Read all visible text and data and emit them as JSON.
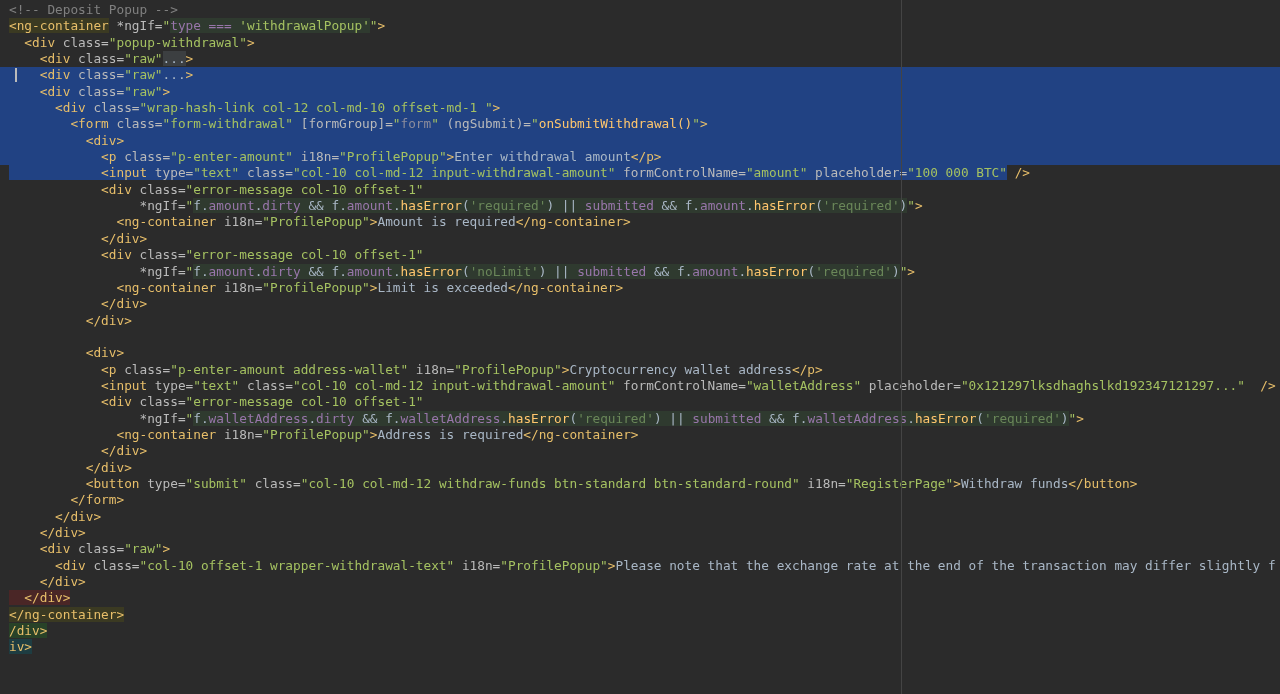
{
  "editor": {
    "lines": [
      {
        "selected": false,
        "cursor": false,
        "tokens": [
          {
            "kind": "comment",
            "text": "<!-- Deposit Popup -->"
          }
        ]
      },
      {
        "selected": false,
        "cursor": false,
        "tokens": [
          {
            "kind": "tag",
            "text": "<ng-container",
            "color": "#3b3a22"
          },
          {
            "kind": "attr",
            "text": " *ngIf="
          },
          {
            "kind": "value",
            "text": "\""
          },
          {
            "kind": "field",
            "text": "type === ",
            "color": "#2f3a2f"
          },
          {
            "kind": "value",
            "text": "'withdrawalPopup'",
            "color": "#2f3a2f"
          },
          {
            "kind": "value",
            "text": "\""
          },
          {
            "kind": "tag",
            "text": ">"
          }
        ]
      },
      {
        "selected": false,
        "cursor": false,
        "tokens": [
          {
            "kind": "tag",
            "text": "  <div"
          },
          {
            "kind": "attr",
            "text": " class="
          },
          {
            "kind": "value",
            "text": "\"popup-withdrawal\""
          },
          {
            "kind": "tag",
            "text": ">"
          }
        ]
      },
      {
        "selected": false,
        "cursor": false,
        "tokens": [
          {
            "kind": "tag",
            "text": "    <div"
          },
          {
            "kind": "attr",
            "text": " class="
          },
          {
            "kind": "value",
            "text": "\"raw\""
          },
          {
            "kind": "plain",
            "text": "...",
            "color": "#3c3f41"
          },
          {
            "kind": "tag",
            "text": ">"
          }
        ]
      },
      {
        "selected": true,
        "cursor": true,
        "tokens": [
          {
            "kind": "tag",
            "text": "    <div"
          },
          {
            "kind": "attr",
            "text": " class="
          },
          {
            "kind": "value",
            "text": "\"raw\""
          },
          {
            "kind": "plain",
            "text": "..."
          },
          {
            "kind": "tag",
            "text": ">"
          }
        ]
      },
      {
        "selected": true,
        "cursor": false,
        "tokens": [
          {
            "kind": "tag",
            "text": "    <div"
          },
          {
            "kind": "attr",
            "text": " class="
          },
          {
            "kind": "value",
            "text": "\"raw\""
          },
          {
            "kind": "tag",
            "text": ">"
          }
        ]
      },
      {
        "selected": true,
        "cursor": false,
        "tokens": [
          {
            "kind": "tag",
            "text": "      <div"
          },
          {
            "kind": "attr",
            "text": " class="
          },
          {
            "kind": "value",
            "text": "\"wrap-hash-link col-12 col-md-10 offset-md-1 \""
          },
          {
            "kind": "tag",
            "text": ">"
          }
        ]
      },
      {
        "selected": true,
        "cursor": false,
        "tokens": [
          {
            "kind": "tag",
            "text": "        <form"
          },
          {
            "kind": "attr",
            "text": " class="
          },
          {
            "kind": "value",
            "text": "\"form-withdrawal\""
          },
          {
            "kind": "attr",
            "text": " [formGroup]="
          },
          {
            "kind": "value",
            "text": "\""
          },
          {
            "kind": "dim",
            "text": "form"
          },
          {
            "kind": "value",
            "text": "\""
          },
          {
            "kind": "attr",
            "text": " (ngSubmit)="
          },
          {
            "kind": "value",
            "text": "\""
          },
          {
            "kind": "call",
            "text": "onSubmitWithdrawal()"
          },
          {
            "kind": "value",
            "text": "\""
          },
          {
            "kind": "tag",
            "text": ">"
          }
        ]
      },
      {
        "selected": true,
        "cursor": false,
        "tokens": [
          {
            "kind": "tag",
            "text": "          <div>"
          }
        ]
      },
      {
        "selected": true,
        "cursor": false,
        "tokens": [
          {
            "kind": "tag",
            "text": "            <p"
          },
          {
            "kind": "attr",
            "text": " class="
          },
          {
            "kind": "value",
            "text": "\"p-enter-amount\""
          },
          {
            "kind": "attr",
            "text": " i18n="
          },
          {
            "kind": "value",
            "text": "\"ProfilePopup\""
          },
          {
            "kind": "tag",
            "text": ">"
          },
          {
            "kind": "plain",
            "text": "Enter withdrawal amount"
          },
          {
            "kind": "tag",
            "text": "</p>"
          }
        ]
      },
      {
        "selected": false,
        "cursor": false,
        "tokens": [
          {
            "kind": "tag",
            "text": "            <input",
            "selected": true
          },
          {
            "kind": "attr",
            "text": " type=",
            "selected": true
          },
          {
            "kind": "value",
            "text": "\"text\"",
            "selected": true
          },
          {
            "kind": "attr",
            "text": " class=",
            "selected": true
          },
          {
            "kind": "value",
            "text": "\"col-10 col-md-12 input-withdrawal-amount\"",
            "selected": true
          },
          {
            "kind": "attr",
            "text": " formControlName=",
            "selected": true
          },
          {
            "kind": "value",
            "text": "\"amount\"",
            "selected": true
          },
          {
            "kind": "attr",
            "text": " placeholder=",
            "selected": true
          },
          {
            "kind": "value",
            "text": "\"100 000 BTC\"",
            "selected": true
          },
          {
            "kind": "tag",
            "text": " />",
            "selected": false
          }
        ]
      },
      {
        "selected": false,
        "cursor": false,
        "tokens": [
          {
            "kind": "tag",
            "text": "            <div"
          },
          {
            "kind": "attr",
            "text": " class="
          },
          {
            "kind": "value",
            "text": "\"error-message col-10 offset-1\""
          }
        ]
      },
      {
        "selected": false,
        "cursor": false,
        "tokens": [
          {
            "kind": "attr",
            "text": "                 *ngIf="
          },
          {
            "kind": "value",
            "text": "\""
          },
          {
            "kind": "plain",
            "text": "f.",
            "color": "#2f3a2f"
          },
          {
            "kind": "field",
            "text": "amount",
            "color": "#2f3a2f"
          },
          {
            "kind": "plain",
            "text": ".",
            "color": "#2f3a2f"
          },
          {
            "kind": "field",
            "text": "dirty",
            "color": "#2f3a2f"
          },
          {
            "kind": "plain",
            "text": " && f.",
            "color": "#2f3a2f"
          },
          {
            "kind": "field",
            "text": "amount",
            "color": "#2f3a2f"
          },
          {
            "kind": "plain",
            "text": ".",
            "color": "#2f3a2f"
          },
          {
            "kind": "call",
            "text": "hasError",
            "color": "#2f3a2f"
          },
          {
            "kind": "plain",
            "text": "(",
            "color": "#2f3a2f"
          },
          {
            "kind": "quote",
            "text": "'required'",
            "color": "#2f3a2f"
          },
          {
            "kind": "plain",
            "text": ") || ",
            "color": "#2f3a2f"
          },
          {
            "kind": "field",
            "text": "submitted",
            "color": "#2f3a2f"
          },
          {
            "kind": "plain",
            "text": " && f.",
            "color": "#2f3a2f"
          },
          {
            "kind": "field",
            "text": "amount",
            "color": "#2f3a2f"
          },
          {
            "kind": "plain",
            "text": ".",
            "color": "#2f3a2f"
          },
          {
            "kind": "call",
            "text": "hasError",
            "color": "#2f3a2f"
          },
          {
            "kind": "plain",
            "text": "(",
            "color": "#2f3a2f"
          },
          {
            "kind": "quote",
            "text": "'required'",
            "color": "#2f3a2f"
          },
          {
            "kind": "plain",
            "text": ")",
            "color": "#2f3a2f"
          },
          {
            "kind": "value",
            "text": "\""
          },
          {
            "kind": "tag",
            "text": ">"
          }
        ]
      },
      {
        "selected": false,
        "cursor": false,
        "tokens": [
          {
            "kind": "tag",
            "text": "              <ng-container"
          },
          {
            "kind": "attr",
            "text": " i18n="
          },
          {
            "kind": "value",
            "text": "\"ProfilePopup\""
          },
          {
            "kind": "tag",
            "text": ">"
          },
          {
            "kind": "plain",
            "text": "Amount is required"
          },
          {
            "kind": "tag",
            "text": "</ng-container>"
          }
        ]
      },
      {
        "selected": false,
        "cursor": false,
        "tokens": [
          {
            "kind": "tag",
            "text": "            </div>"
          }
        ]
      },
      {
        "selected": false,
        "cursor": false,
        "tokens": [
          {
            "kind": "tag",
            "text": "            <div"
          },
          {
            "kind": "attr",
            "text": " class="
          },
          {
            "kind": "value",
            "text": "\"error-message col-10 offset-1\""
          }
        ]
      },
      {
        "selected": false,
        "cursor": false,
        "tokens": [
          {
            "kind": "attr",
            "text": "                 *ngIf="
          },
          {
            "kind": "value",
            "text": "\""
          },
          {
            "kind": "plain",
            "text": "f.",
            "color": "#2f3a2f"
          },
          {
            "kind": "field",
            "text": "amount",
            "color": "#2f3a2f"
          },
          {
            "kind": "plain",
            "text": ".",
            "color": "#2f3a2f"
          },
          {
            "kind": "field",
            "text": "dirty",
            "color": "#2f3a2f"
          },
          {
            "kind": "plain",
            "text": " && f.",
            "color": "#2f3a2f"
          },
          {
            "kind": "field",
            "text": "amount",
            "color": "#2f3a2f"
          },
          {
            "kind": "plain",
            "text": ".",
            "color": "#2f3a2f"
          },
          {
            "kind": "call",
            "text": "hasError",
            "color": "#2f3a2f"
          },
          {
            "kind": "plain",
            "text": "(",
            "color": "#2f3a2f"
          },
          {
            "kind": "quote",
            "text": "'noLimit'",
            "color": "#2f3a2f"
          },
          {
            "kind": "plain",
            "text": ") || ",
            "color": "#2f3a2f"
          },
          {
            "kind": "field",
            "text": "submitted",
            "color": "#2f3a2f"
          },
          {
            "kind": "plain",
            "text": " && f.",
            "color": "#2f3a2f"
          },
          {
            "kind": "field",
            "text": "amount",
            "color": "#2f3a2f"
          },
          {
            "kind": "plain",
            "text": ".",
            "color": "#2f3a2f"
          },
          {
            "kind": "call",
            "text": "hasError",
            "color": "#2f3a2f"
          },
          {
            "kind": "plain",
            "text": "(",
            "color": "#2f3a2f"
          },
          {
            "kind": "quote",
            "text": "'required'",
            "color": "#2f3a2f"
          },
          {
            "kind": "plain",
            "text": ")",
            "color": "#2f3a2f"
          },
          {
            "kind": "value",
            "text": "\""
          },
          {
            "kind": "tag",
            "text": ">"
          }
        ]
      },
      {
        "selected": false,
        "cursor": false,
        "tokens": [
          {
            "kind": "tag",
            "text": "              <ng-container"
          },
          {
            "kind": "attr",
            "text": " i18n="
          },
          {
            "kind": "value",
            "text": "\"ProfilePopup\""
          },
          {
            "kind": "tag",
            "text": ">"
          },
          {
            "kind": "plain",
            "text": "Limit is exceeded"
          },
          {
            "kind": "tag",
            "text": "</ng-container>"
          }
        ]
      },
      {
        "selected": false,
        "cursor": false,
        "tokens": [
          {
            "kind": "tag",
            "text": "            </div>"
          }
        ]
      },
      {
        "selected": false,
        "cursor": false,
        "tokens": [
          {
            "kind": "tag",
            "text": "          </div>"
          }
        ]
      },
      {
        "selected": false,
        "cursor": false
      },
      {
        "selected": false,
        "cursor": false,
        "tokens": [
          {
            "kind": "tag",
            "text": "          <div>"
          }
        ]
      },
      {
        "selected": false,
        "cursor": false,
        "tokens": [
          {
            "kind": "tag",
            "text": "            <p"
          },
          {
            "kind": "attr",
            "text": " class="
          },
          {
            "kind": "value",
            "text": "\"p-enter-amount address-wallet\""
          },
          {
            "kind": "attr",
            "text": " i18n="
          },
          {
            "kind": "value",
            "text": "\"ProfilePopup\""
          },
          {
            "kind": "tag",
            "text": ">"
          },
          {
            "kind": "plain",
            "text": "Cryptocurrency wallet address"
          },
          {
            "kind": "tag",
            "text": "</p>"
          }
        ]
      },
      {
        "selected": false,
        "cursor": false,
        "tokens": [
          {
            "kind": "tag",
            "text": "            <input"
          },
          {
            "kind": "attr",
            "text": " type="
          },
          {
            "kind": "value",
            "text": "\"text\""
          },
          {
            "kind": "attr",
            "text": " class="
          },
          {
            "kind": "value",
            "text": "\"col-10 col-md-12 input-withdrawal-amount\""
          },
          {
            "kind": "attr",
            "text": " formControlName="
          },
          {
            "kind": "value",
            "text": "\"walletAddress\""
          },
          {
            "kind": "attr",
            "text": " placeholder="
          },
          {
            "kind": "value",
            "text": "\"0x121297lksdhaghslkd192347121297...\""
          },
          {
            "kind": "tag",
            "text": "  />"
          }
        ]
      },
      {
        "selected": false,
        "cursor": false,
        "tokens": [
          {
            "kind": "tag",
            "text": "            <div"
          },
          {
            "kind": "attr",
            "text": " class="
          },
          {
            "kind": "value",
            "text": "\"error-message col-10 offset-1\""
          }
        ]
      },
      {
        "selected": false,
        "cursor": false,
        "tokens": [
          {
            "kind": "attr",
            "text": "                 *ngIf="
          },
          {
            "kind": "value",
            "text": "\""
          },
          {
            "kind": "plain",
            "text": "f.",
            "color": "#2f3a2f"
          },
          {
            "kind": "field",
            "text": "walletAddress",
            "color": "#2f3a2f"
          },
          {
            "kind": "plain",
            "text": ".",
            "color": "#2f3a2f"
          },
          {
            "kind": "field",
            "text": "dirty",
            "color": "#2f3a2f"
          },
          {
            "kind": "plain",
            "text": " && f.",
            "color": "#2f3a2f"
          },
          {
            "kind": "field",
            "text": "walletAddress",
            "color": "#2f3a2f"
          },
          {
            "kind": "plain",
            "text": ".",
            "color": "#2f3a2f"
          },
          {
            "kind": "call",
            "text": "hasError",
            "color": "#2f3a2f"
          },
          {
            "kind": "plain",
            "text": "(",
            "color": "#2f3a2f"
          },
          {
            "kind": "quote",
            "text": "'required'",
            "color": "#2f3a2f"
          },
          {
            "kind": "plain",
            "text": ") || ",
            "color": "#2f3a2f"
          },
          {
            "kind": "field",
            "text": "submitted",
            "color": "#2f3a2f"
          },
          {
            "kind": "plain",
            "text": " && f.",
            "color": "#2f3a2f"
          },
          {
            "kind": "field",
            "text": "walletAddress",
            "color": "#2f3a2f"
          },
          {
            "kind": "plain",
            "text": ".",
            "color": "#2f3a2f"
          },
          {
            "kind": "call",
            "text": "hasError",
            "color": "#2f3a2f"
          },
          {
            "kind": "plain",
            "text": "(",
            "color": "#2f3a2f"
          },
          {
            "kind": "quote",
            "text": "'required'",
            "color": "#2f3a2f"
          },
          {
            "kind": "plain",
            "text": ")",
            "color": "#2f3a2f"
          },
          {
            "kind": "value",
            "text": "\""
          },
          {
            "kind": "tag",
            "text": ">"
          }
        ]
      },
      {
        "selected": false,
        "cursor": false,
        "tokens": [
          {
            "kind": "tag",
            "text": "              <ng-container"
          },
          {
            "kind": "attr",
            "text": " i18n="
          },
          {
            "kind": "value",
            "text": "\"ProfilePopup\""
          },
          {
            "kind": "tag",
            "text": ">"
          },
          {
            "kind": "plain",
            "text": "Address is required"
          },
          {
            "kind": "tag",
            "text": "</ng-container>"
          }
        ]
      },
      {
        "selected": false,
        "cursor": false,
        "tokens": [
          {
            "kind": "tag",
            "text": "            </div>"
          }
        ]
      },
      {
        "selected": false,
        "cursor": false,
        "tokens": [
          {
            "kind": "tag",
            "text": "          </div>"
          }
        ]
      },
      {
        "selected": false,
        "cursor": false,
        "tokens": [
          {
            "kind": "tag",
            "text": "          <button"
          },
          {
            "kind": "attr",
            "text": " type="
          },
          {
            "kind": "value",
            "text": "\"submit\""
          },
          {
            "kind": "attr",
            "text": " class="
          },
          {
            "kind": "value",
            "text": "\"col-10 col-md-12 withdraw-funds btn-standard btn-standard-round\""
          },
          {
            "kind": "attr",
            "text": " i18n="
          },
          {
            "kind": "value",
            "text": "\"RegisterPage\""
          },
          {
            "kind": "tag",
            "text": ">"
          },
          {
            "kind": "plain",
            "text": "Withdraw funds"
          },
          {
            "kind": "tag",
            "text": "</button>"
          }
        ]
      },
      {
        "selected": false,
        "cursor": false,
        "tokens": [
          {
            "kind": "tag",
            "text": "        </form>"
          }
        ]
      },
      {
        "selected": false,
        "cursor": false,
        "tokens": [
          {
            "kind": "tag",
            "text": "      </div>"
          }
        ]
      },
      {
        "selected": false,
        "cursor": false,
        "tokens": [
          {
            "kind": "tag",
            "text": "    </div>"
          }
        ]
      },
      {
        "selected": false,
        "cursor": false,
        "tokens": [
          {
            "kind": "tag",
            "text": "    <div"
          },
          {
            "kind": "attr",
            "text": " class="
          },
          {
            "kind": "value",
            "text": "\"raw\""
          },
          {
            "kind": "tag",
            "text": ">"
          }
        ]
      },
      {
        "selected": false,
        "cursor": false,
        "tokens": [
          {
            "kind": "tag",
            "text": "      <div"
          },
          {
            "kind": "attr",
            "text": " class="
          },
          {
            "kind": "value",
            "text": "\"col-10 offset-1 wrapper-withdrawal-text\""
          },
          {
            "kind": "attr",
            "text": " i18n="
          },
          {
            "kind": "value",
            "text": "\"ProfilePopup\""
          },
          {
            "kind": "tag",
            "text": ">"
          },
          {
            "kind": "plain",
            "text": "Please note that the exchange rate at the end of the transaction may differ slightly f"
          }
        ]
      },
      {
        "selected": false,
        "cursor": false,
        "tokens": [
          {
            "kind": "tag",
            "text": "    </div>"
          }
        ]
      },
      {
        "selected": false,
        "cursor": false,
        "tokens": [
          {
            "kind": "tag",
            "text": "  </div>",
            "color": "#4a2626"
          }
        ]
      },
      {
        "selected": false,
        "cursor": false,
        "tokens": [
          {
            "kind": "tag",
            "text": "</ng-container>",
            "color": "#3b3a22"
          }
        ]
      },
      {
        "selected": false,
        "cursor": false,
        "tokens": [
          {
            "kind": "tag",
            "text": "/div>",
            "color": "#284228"
          }
        ]
      },
      {
        "selected": false,
        "cursor": false,
        "tokens": [
          {
            "kind": "tag",
            "text": "iv>",
            "color": "#1e3d42"
          }
        ]
      }
    ]
  }
}
